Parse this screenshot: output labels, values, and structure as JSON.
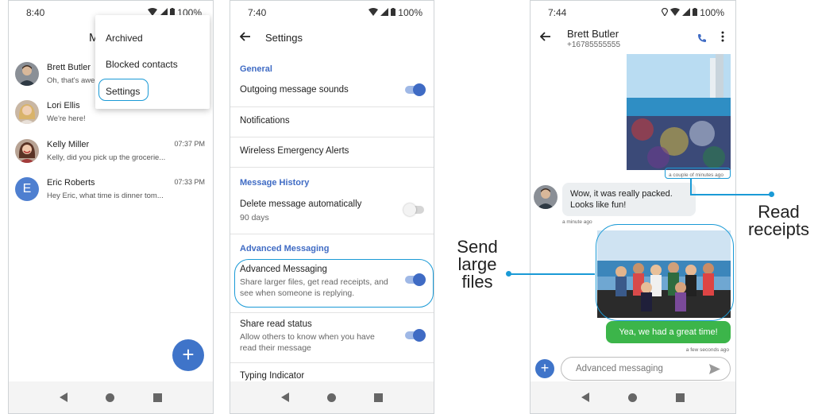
{
  "phone1": {
    "status_time": "8:40",
    "battery": "100%",
    "header_partial": "M",
    "menu": {
      "items": [
        "Archived",
        "Blocked contacts",
        "Settings"
      ]
    },
    "conversations": [
      {
        "name": "Brett Butler",
        "snippet": "Oh, that's awe",
        "time": ""
      },
      {
        "name": "Lori Ellis",
        "snippet": "We're here!",
        "time": ""
      },
      {
        "name": "Kelly Miller",
        "snippet": "Kelly, did you pick up the grocerie...",
        "time": "07:37 PM"
      },
      {
        "name": "Eric Roberts",
        "snippet": "Hey Eric, what time is dinner tom...",
        "time": "07:33 PM",
        "initial": "E"
      }
    ],
    "fab_label": "+"
  },
  "phone2": {
    "status_time": "7:40",
    "battery": "100%",
    "title": "Settings",
    "sections": {
      "general": "General",
      "history": "Message History",
      "advanced": "Advanced Messaging"
    },
    "items": {
      "outgoing": "Outgoing message sounds",
      "notifications": "Notifications",
      "wireless": "Wireless Emergency Alerts",
      "delete": "Delete message automatically",
      "delete_sub": "90 days",
      "adv": "Advanced Messaging",
      "adv_sub": "Share larger files, get read receipts, and see when someone is replying.",
      "share": "Share read status",
      "share_sub": "Allow others to know when you have read their message",
      "typing": "Typing Indicator"
    }
  },
  "phone3": {
    "status_time": "7:44",
    "battery": "100%",
    "contact_name": "Brett Butler",
    "contact_number": "+16785555555",
    "ts_photo": "a couple of minutes ago",
    "incoming_msg": "Wow, it was really packed. Looks like fun!",
    "ts_incoming": "a minute ago",
    "outgoing_msg": "Yea, we had a great time!",
    "ts_outgoing": "a few seconds ago",
    "input_placeholder": "Advanced messaging",
    "add_label": "+"
  },
  "annotations": {
    "send_large": "Send\nlarge\nfiles",
    "read_receipts": "Read\nreceipts"
  },
  "colors": {
    "accent": "#3f6bc4",
    "highlight": "#1a9ad6",
    "sent_bubble": "#3cb54a",
    "fab": "#3f74c9"
  }
}
